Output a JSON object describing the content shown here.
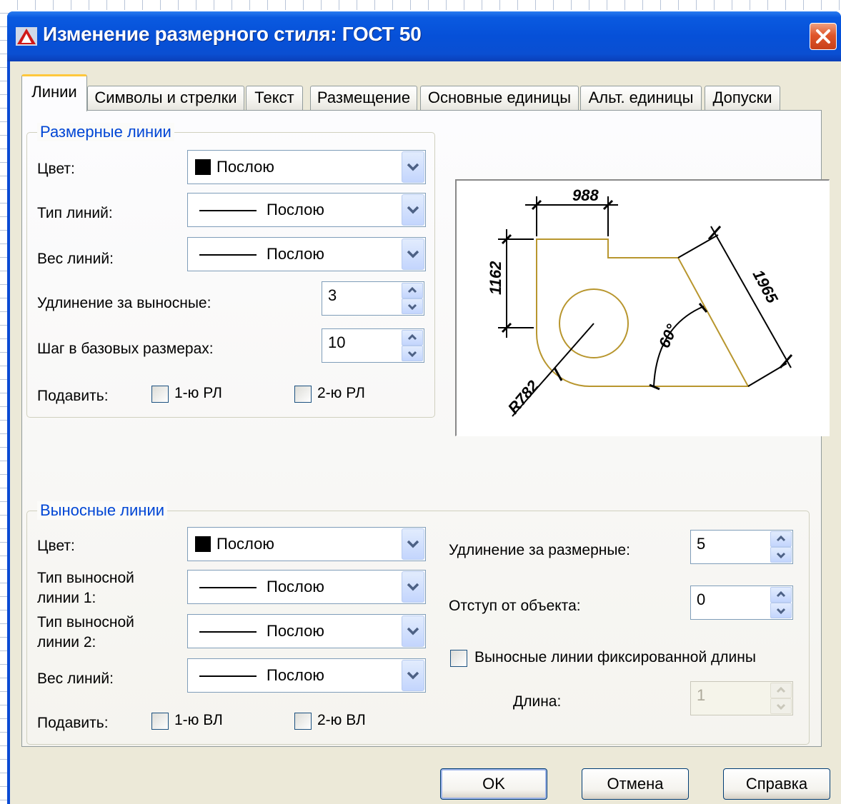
{
  "window": {
    "title": "Изменение размерного стиля: ГОСТ 50"
  },
  "tabs": [
    {
      "label": "Линии",
      "active": true
    },
    {
      "label": "Символы и стрелки"
    },
    {
      "label": "Текст"
    },
    {
      "label": "Размещение"
    },
    {
      "label": "Основные единицы"
    },
    {
      "label": "Альт. единицы"
    },
    {
      "label": "Допуски"
    }
  ],
  "dimension_lines": {
    "title": "Размерные линии",
    "color_label": "Цвет:",
    "color_value": "Послою",
    "linetype_label": "Тип линий:",
    "linetype_value": "Послою",
    "lineweight_label": "Вес линий:",
    "lineweight_value": "Послою",
    "extend_label": "Удлинение за выносные:",
    "extend_value": "3",
    "baseline_label": "Шаг в базовых размерах:",
    "baseline_value": "10",
    "suppress_label": "Подавить:",
    "suppress_1": "1-ю РЛ",
    "suppress_2": "2-ю РЛ"
  },
  "extension_lines": {
    "title": "Выносные линии",
    "color_label": "Цвет:",
    "color_value": "Послою",
    "linetype1_label": "Тип выносной линии 1:",
    "linetype1_value": "Послою",
    "linetype2_label": "Тип выносной линии 2:",
    "linetype2_value": "Послою",
    "lineweight_label": "Вес линий:",
    "lineweight_value": "Послою",
    "suppress_label": "Подавить:",
    "suppress_1": "1-ю ВЛ",
    "suppress_2": "2-ю ВЛ",
    "extend_label": "Удлинение за размерные:",
    "extend_value": "5",
    "offset_label": "Отступ от объекта:",
    "offset_value": "0",
    "fixed_label": "Выносные линии фиксированной длины",
    "length_label": "Длина:",
    "length_value": "1"
  },
  "preview": {
    "dim_top": "988",
    "dim_left": "1162",
    "dim_right": "1965",
    "dim_angle": "60°",
    "dim_radius": "R782"
  },
  "buttons": {
    "ok": "OK",
    "cancel": "Отмена",
    "help": "Справка"
  },
  "colors": {
    "title_bar": "#0650d8",
    "group_title": "#0046d5",
    "dialog_bg": "#ece9d8",
    "preview_geometry": "#b8962e"
  }
}
